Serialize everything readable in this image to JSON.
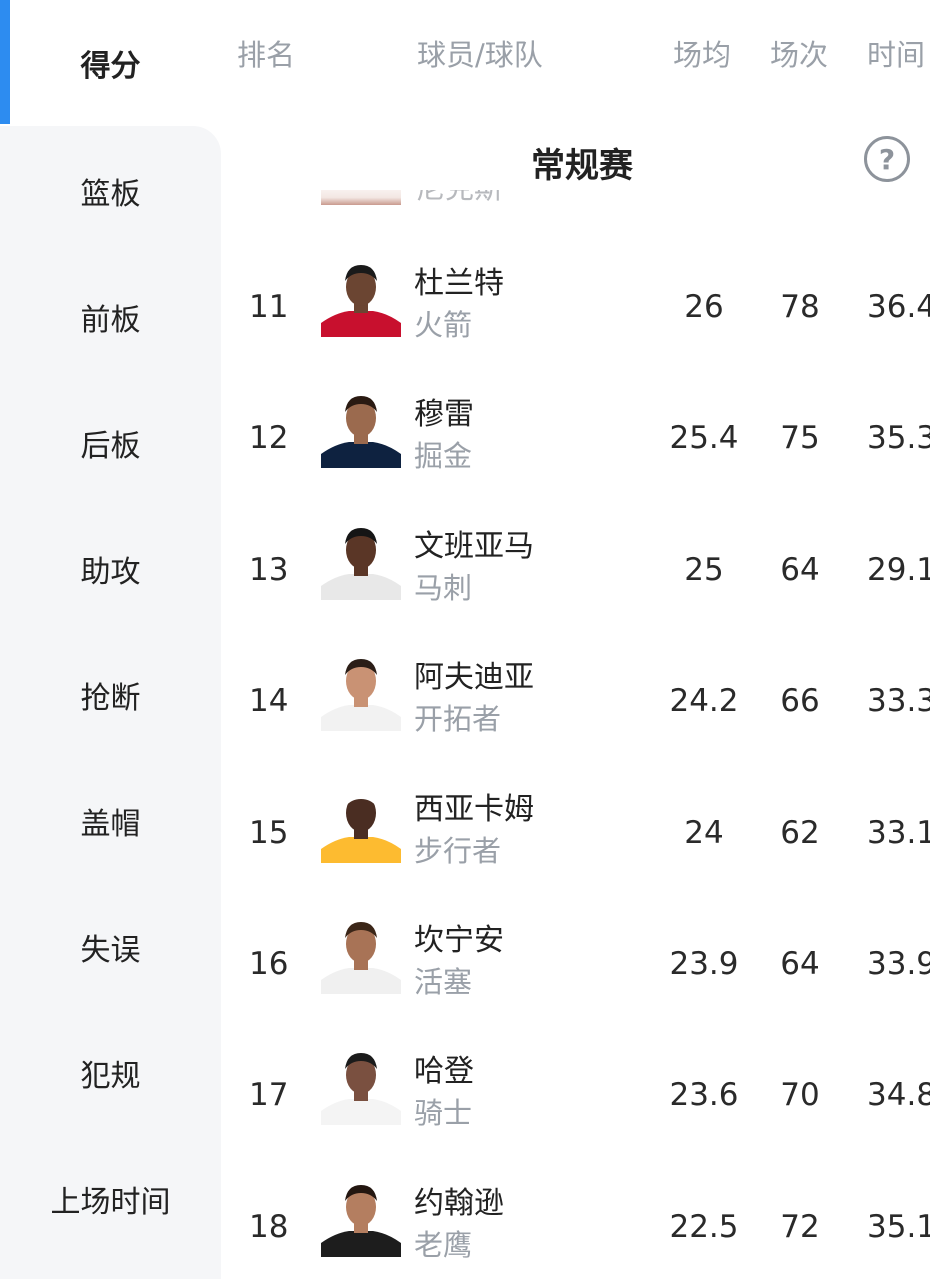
{
  "sidebar": {
    "items": [
      {
        "label": "得分",
        "active": true
      },
      {
        "label": "篮板"
      },
      {
        "label": "前板"
      },
      {
        "label": "后板"
      },
      {
        "label": "助攻"
      },
      {
        "label": "抢断"
      },
      {
        "label": "盖帽"
      },
      {
        "label": "失误"
      },
      {
        "label": "犯规"
      },
      {
        "label": "上场时间"
      }
    ]
  },
  "columns": {
    "rank": "排名",
    "player_team": "球员/球队",
    "ppg": "场均",
    "games": "场次",
    "minutes": "时间"
  },
  "section": {
    "title": "常规赛",
    "help_icon": "question-circle-icon"
  },
  "partial_prev": {
    "name": "尼克斯"
  },
  "rows": [
    {
      "rank": "11",
      "name": "杜兰特",
      "team": "火箭",
      "ppg": "26",
      "games": "78",
      "minutes": "36.4",
      "skin": "#6b4532",
      "jersey": "#c8102e",
      "hair": "#1a1a1a"
    },
    {
      "rank": "12",
      "name": "穆雷",
      "team": "掘金",
      "ppg": "25.4",
      "games": "75",
      "minutes": "35.3",
      "skin": "#9b6a4e",
      "jersey": "#0e2240",
      "hair": "#2a1a12"
    },
    {
      "rank": "13",
      "name": "文班亚马",
      "team": "马刺",
      "ppg": "25",
      "games": "64",
      "minutes": "29.1",
      "skin": "#5a3626",
      "jersey": "#e8e8e8",
      "hair": "#151515"
    },
    {
      "rank": "14",
      "name": "阿夫迪亚",
      "team": "开拓者",
      "ppg": "24.2",
      "games": "66",
      "minutes": "33.3",
      "skin": "#c99274",
      "jersey": "#f2f2f2",
      "hair": "#2b1e17"
    },
    {
      "rank": "15",
      "name": "西亚卡姆",
      "team": "步行者",
      "ppg": "24",
      "games": "62",
      "minutes": "33.1",
      "skin": "#4a2d22",
      "jersey": "#fdbb30",
      "hair": "#ffffff"
    },
    {
      "rank": "16",
      "name": "坎宁安",
      "team": "活塞",
      "ppg": "23.9",
      "games": "64",
      "minutes": "33.9",
      "skin": "#a87356",
      "jersey": "#f0f0f0",
      "hair": "#3b2618"
    },
    {
      "rank": "17",
      "name": "哈登",
      "team": "骑士",
      "ppg": "23.6",
      "games": "70",
      "minutes": "34.8",
      "skin": "#7a5040",
      "jersey": "#f4f4f4",
      "hair": "#1b1b1b"
    },
    {
      "rank": "18",
      "name": "约翰逊",
      "team": "老鹰",
      "ppg": "22.5",
      "games": "72",
      "minutes": "35.1",
      "skin": "#b47e60",
      "jersey": "#1d1d1d",
      "hair": "#231610"
    }
  ]
}
